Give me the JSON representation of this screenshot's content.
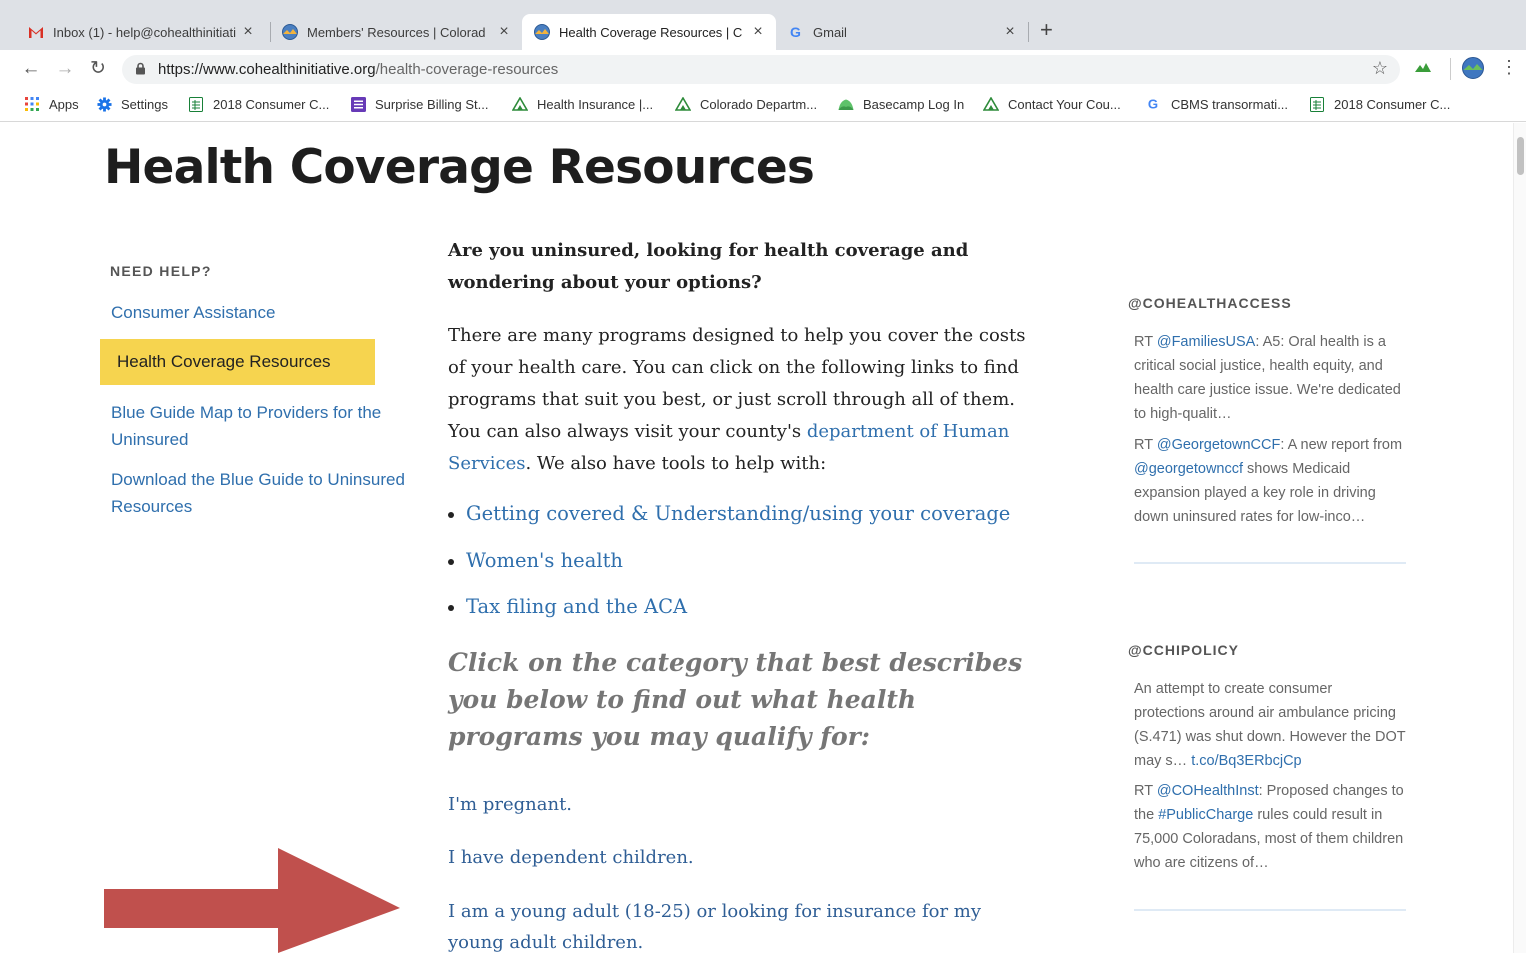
{
  "browser": {
    "tabs": [
      {
        "title": "Inbox (1) - help@cohealthinitiati",
        "icon": "gmail-icon"
      },
      {
        "title": "Members' Resources | Colorad",
        "icon": "site-icon"
      },
      {
        "title": "Health Coverage Resources | C",
        "icon": "site-icon"
      },
      {
        "title": "Gmail",
        "icon": "google-icon"
      }
    ],
    "new_tab_label": "+",
    "close_label": "×",
    "url_host": "https://www.cohealthinitiative.org",
    "url_path": "/health-coverage-resources",
    "bookmarks": [
      {
        "label": "Apps",
        "icon": "apps-grid-icon"
      },
      {
        "label": "Settings",
        "icon": "gear-icon"
      },
      {
        "label": "2018 Consumer C...",
        "icon": "sheets-icon"
      },
      {
        "label": "Surprise Billing St...",
        "icon": "forms-icon"
      },
      {
        "label": "Health Insurance |...",
        "icon": "mountain-icon"
      },
      {
        "label": "Colorado Departm...",
        "icon": "mountain-icon"
      },
      {
        "label": "Basecamp Log In",
        "icon": "basecamp-icon"
      },
      {
        "label": "Contact Your Cou...",
        "icon": "mountain-icon"
      },
      {
        "label": "CBMS transormati...",
        "icon": "google-icon"
      },
      {
        "label": "2018 Consumer C...",
        "icon": "sheets-icon"
      }
    ]
  },
  "page": {
    "title": "Health Coverage Resources",
    "sidebar": {
      "heading": "NEED HELP?",
      "links": [
        "Consumer Assistance",
        "Health Coverage Resources",
        "Blue Guide Map to Providers for the Uninsured",
        "Download the Blue Guide to Uninsured Resources"
      ]
    },
    "main": {
      "intro": "Are you uninsured, looking for health coverage and wondering about your options?",
      "para_before": "There are many programs designed to help you cover the costs of your health care. You can click on the following links to find programs that suit you best, or just scroll through all of them. You can also always visit your county's ",
      "para_link": "department of Human Services",
      "para_after": ". We also have tools to help with:",
      "bullets": [
        "Getting covered & Understanding/using your coverage",
        "Women's health",
        "Tax filing and the ACA"
      ],
      "category_heading": "Click on the category that best describes you below to find out what health programs you may qualify for:",
      "categories": [
        "I'm pregnant.",
        "I have dependent children.",
        "I am a young adult (18-25) or looking for insurance for my young adult children."
      ]
    },
    "feeds": [
      {
        "heading": "@COHEALTHACCESS",
        "tweets": [
          {
            "pre": "RT ",
            "handle": "@FamiliesUSA",
            "text": ": A5: Oral health is a critical social justice, health equity, and health care justice issue. We're dedicated to high-qualit…"
          },
          {
            "pre": "RT ",
            "handle": "@GeorgetownCCF",
            "text": ": A new report from ",
            "handle2": "@georgetownccf",
            "text2": " shows Medicaid expansion played a key role in driving down uninsured rates for low-inco…"
          }
        ]
      },
      {
        "heading": "@CCHIPOLICY",
        "tweets": [
          {
            "pre": "An attempt to create consumer protections around air ambulance pricing (S.471) was shut down. However the DOT may s… ",
            "handle": "t.co/Bq3ERbcjCp",
            "text": ""
          },
          {
            "pre": "RT ",
            "handle": "@COHealthInst",
            "text": ": Proposed changes to the ",
            "handle2": "#PublicCharge",
            "text2": " rules could result in 75,000 Coloradans, most of them children who are citizens of…"
          }
        ]
      }
    ]
  },
  "colors": {
    "link": "#2f6fad",
    "highlight": "#f6d44f",
    "arrow": "#c0504d"
  }
}
